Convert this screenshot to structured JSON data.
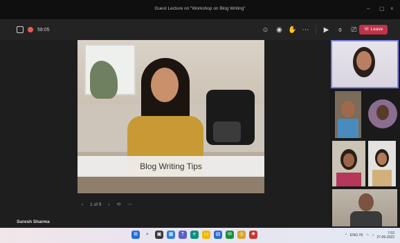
{
  "window": {
    "title": "Guest Lecture on \"Workshop on Blog Writing\""
  },
  "toolbar": {
    "time": "58:05",
    "leave_label": "Leave",
    "icons": [
      "people-icon",
      "chat-icon",
      "reactions-icon",
      "more-icon",
      "camera-icon",
      "mic-icon",
      "share-icon"
    ]
  },
  "slide": {
    "caption": "Blog Writing Tips",
    "page_indicator": "1 of 9"
  },
  "presenter": {
    "name": "Suresh Sharma"
  },
  "participants": {
    "count": 6,
    "tiles": [
      "participant-1",
      "participant-2",
      "participant-3",
      "participant-4",
      "participant-5",
      "participant-6"
    ]
  },
  "taskbar": {
    "time": "7:02",
    "date": "27-09-2022",
    "lang": "ENG IN",
    "apps": [
      "start-icon",
      "search-icon",
      "task-view-icon",
      "widgets-icon",
      "teams-icon",
      "edge-icon",
      "explorer-icon",
      "store-icon",
      "mail-icon",
      "chrome-icon",
      "photos-icon"
    ]
  },
  "colors": {
    "accent": "#7b83eb",
    "leave": "#c4314b",
    "background": "#1f1f1f"
  }
}
